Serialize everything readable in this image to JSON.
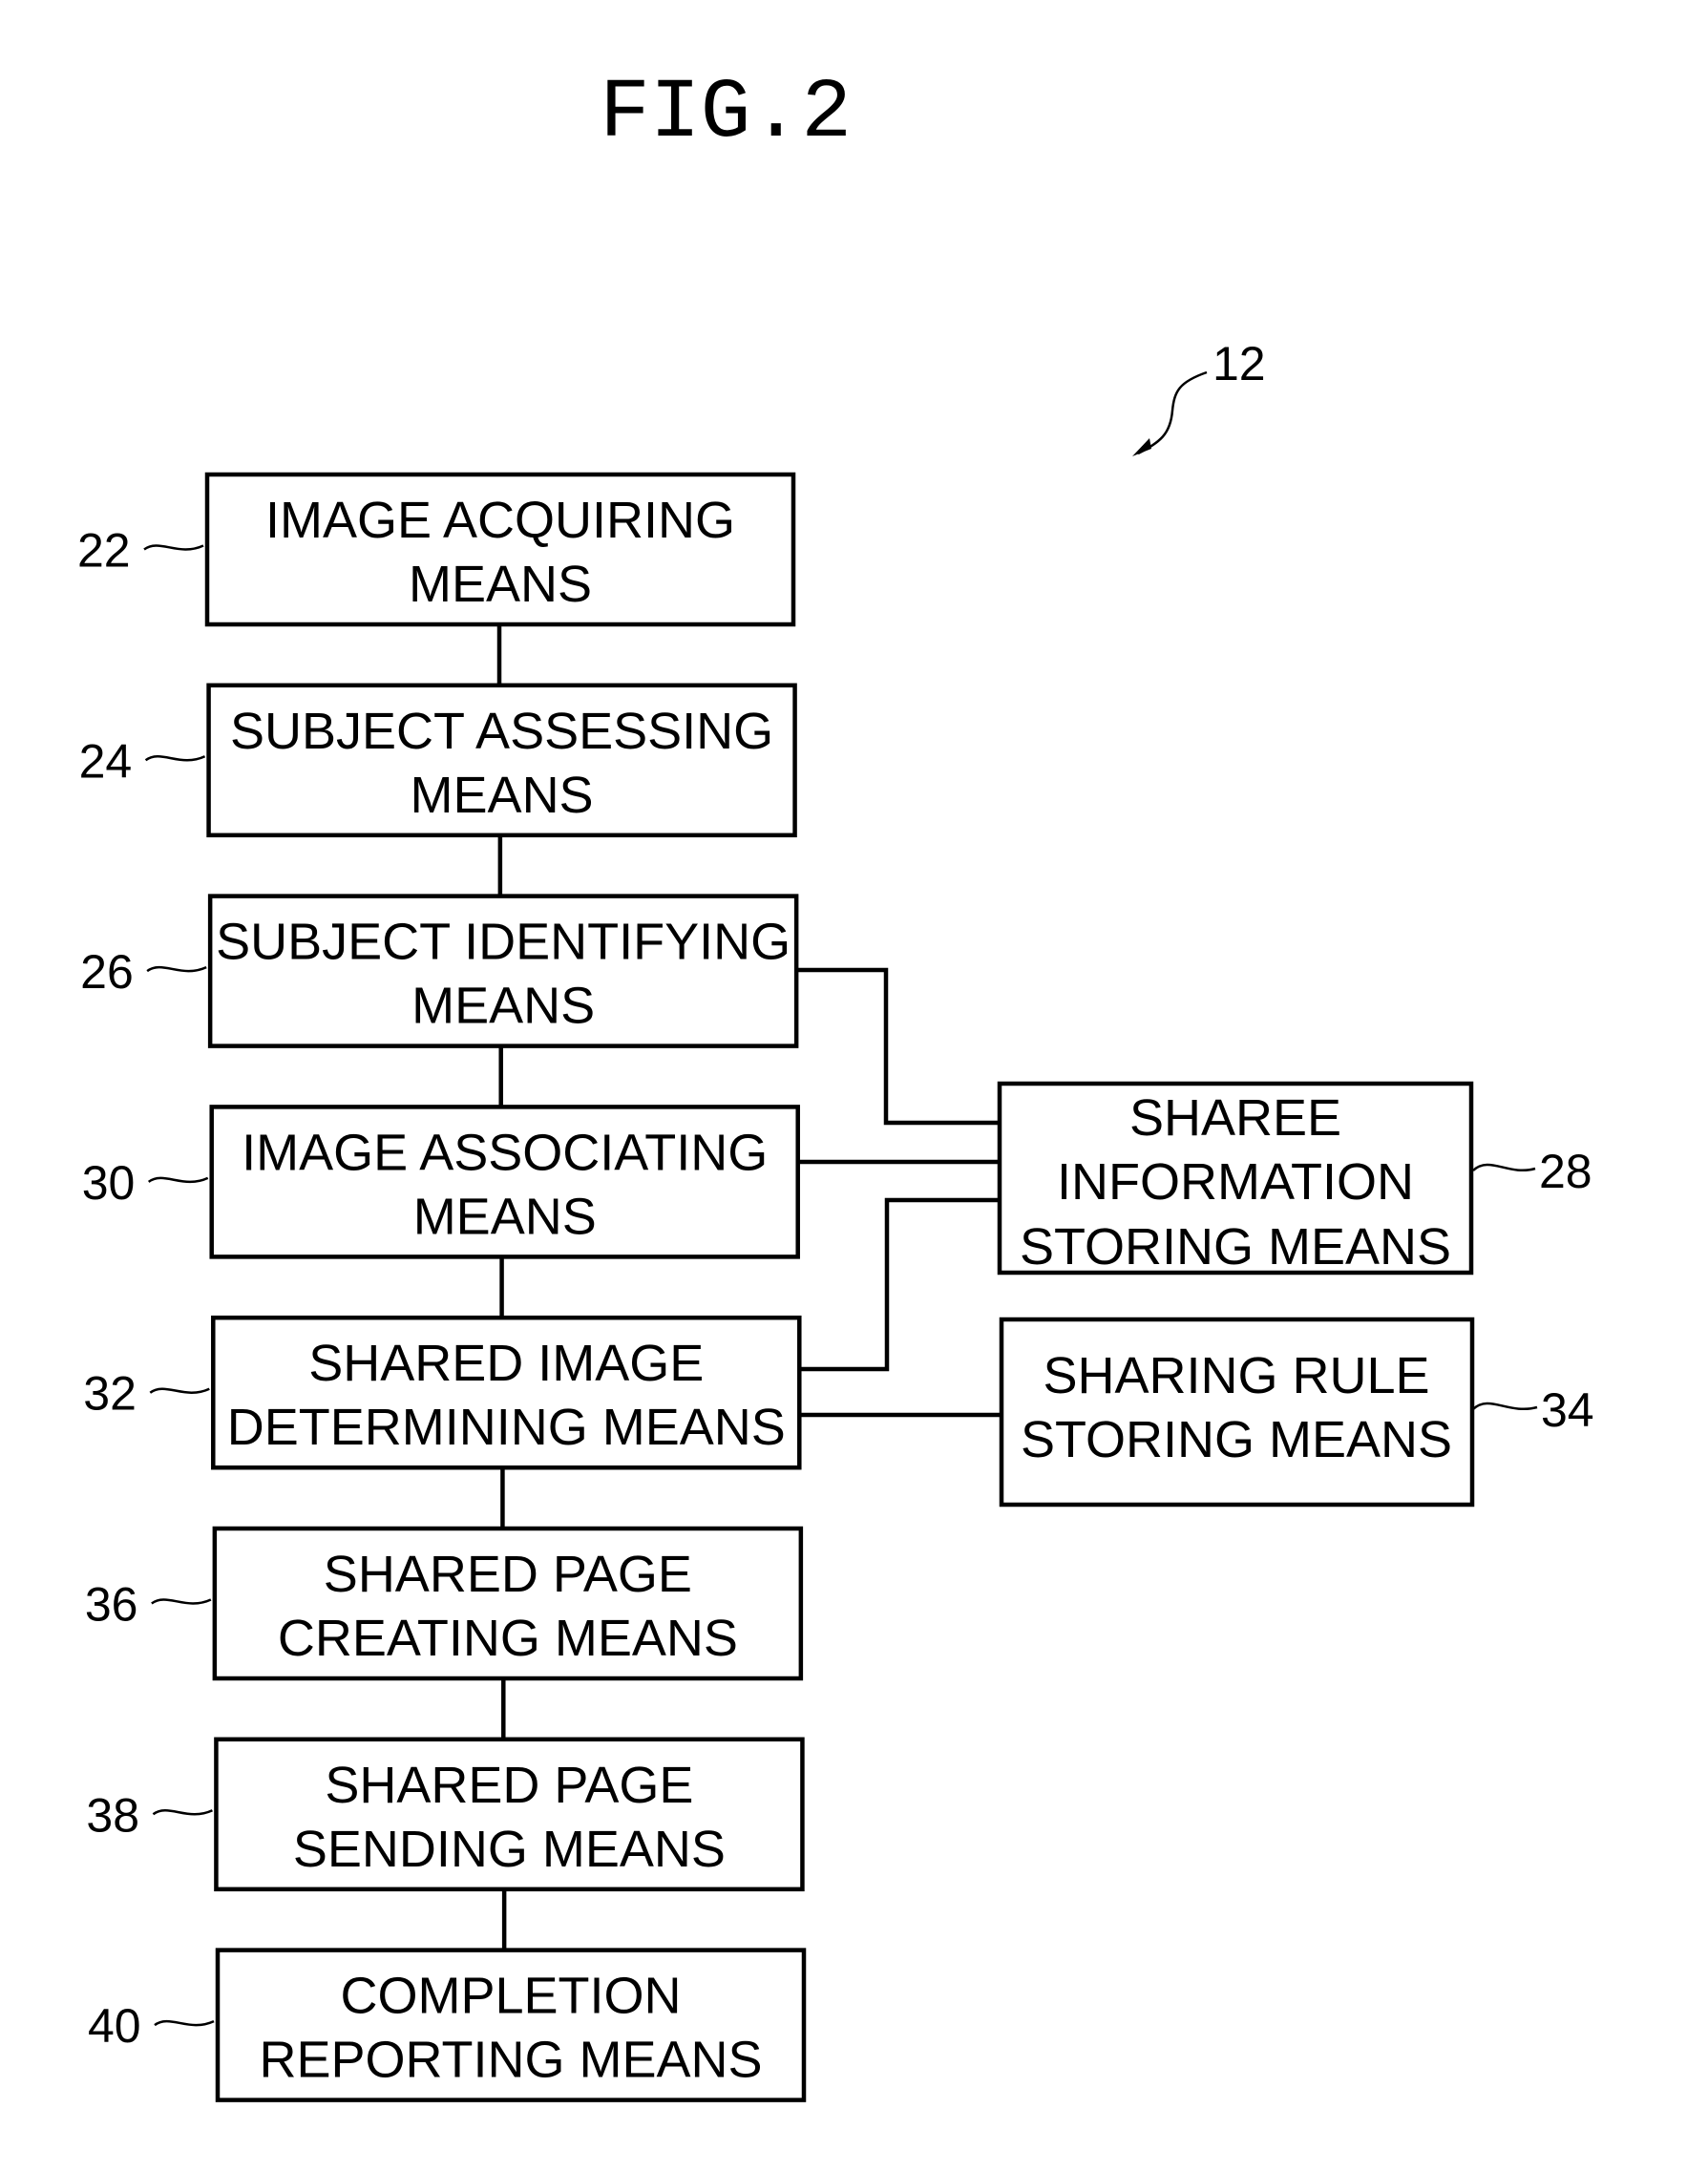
{
  "figure": {
    "title": "FIG.2",
    "device_ref": "12"
  },
  "blocks": [
    {
      "id": "22",
      "ref": "22",
      "lines": [
        "IMAGE ACQUIRING",
        "MEANS"
      ]
    },
    {
      "id": "24",
      "ref": "24",
      "lines": [
        "SUBJECT ASSESSING",
        "MEANS"
      ]
    },
    {
      "id": "26",
      "ref": "26",
      "lines": [
        "SUBJECT IDENTIFYING",
        "MEANS"
      ]
    },
    {
      "id": "30",
      "ref": "30",
      "lines": [
        "IMAGE ASSOCIATING",
        "MEANS"
      ]
    },
    {
      "id": "32",
      "ref": "32",
      "lines": [
        "SHARED IMAGE",
        "DETERMINING MEANS"
      ]
    },
    {
      "id": "36",
      "ref": "36",
      "lines": [
        "SHARED PAGE",
        "CREATING MEANS"
      ]
    },
    {
      "id": "38",
      "ref": "38",
      "lines": [
        "SHARED PAGE",
        "SENDING MEANS"
      ]
    },
    {
      "id": "40",
      "ref": "40",
      "lines": [
        "COMPLETION",
        "REPORTING MEANS"
      ]
    }
  ],
  "side_blocks": [
    {
      "id": "28",
      "ref": "28",
      "lines": [
        "SHAREE",
        "INFORMATION",
        "STORING MEANS"
      ]
    },
    {
      "id": "34",
      "ref": "34",
      "lines": [
        "SHARING RULE",
        "STORING MEANS"
      ]
    }
  ],
  "connections": [
    {
      "from": "22",
      "to": "24"
    },
    {
      "from": "24",
      "to": "26"
    },
    {
      "from": "26",
      "to": "30"
    },
    {
      "from": "30",
      "to": "32"
    },
    {
      "from": "32",
      "to": "36"
    },
    {
      "from": "36",
      "to": "38"
    },
    {
      "from": "38",
      "to": "40"
    },
    {
      "from": "26",
      "to": "28"
    },
    {
      "from": "30",
      "to": "28"
    },
    {
      "from": "32",
      "to": "28"
    },
    {
      "from": "32",
      "to": "34"
    }
  ]
}
